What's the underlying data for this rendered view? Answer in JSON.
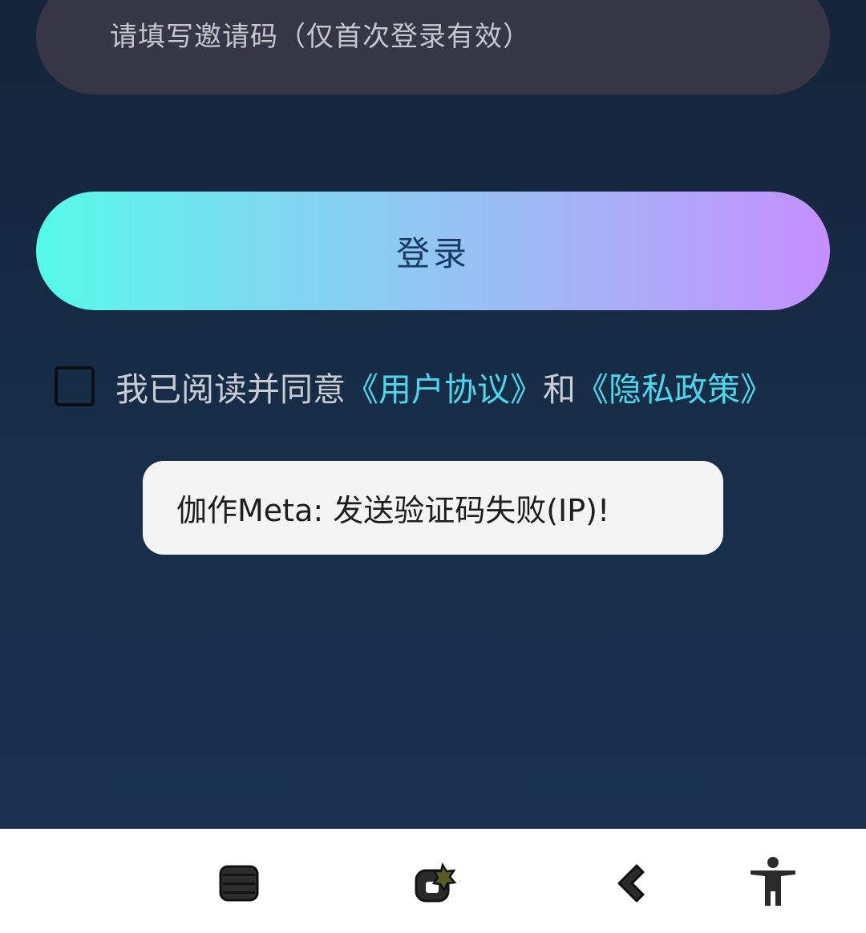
{
  "invite": {
    "placeholder": "请填写邀请码（仅首次登录有效）",
    "value": ""
  },
  "login_button": {
    "label": "登录"
  },
  "agreement": {
    "checked": false,
    "prefix": "我已阅读并同意",
    "user_agreement": "《用户协议》",
    "conjunction": "和",
    "privacy_policy": "《隐私政策》"
  },
  "toast": {
    "message": "伽作Meta: 发送验证码失败(IP)!"
  },
  "navbar": {
    "icons": [
      "menu-icon",
      "app-switch-icon",
      "back-icon",
      "accessibility-icon"
    ]
  },
  "colors": {
    "background": "#162a44",
    "input_bg": "#363646",
    "button_gradient_start": "#55fbe9",
    "button_gradient_end": "#c48ffe",
    "link": "#4fd6ea",
    "toast_bg": "#f4f4f4"
  }
}
